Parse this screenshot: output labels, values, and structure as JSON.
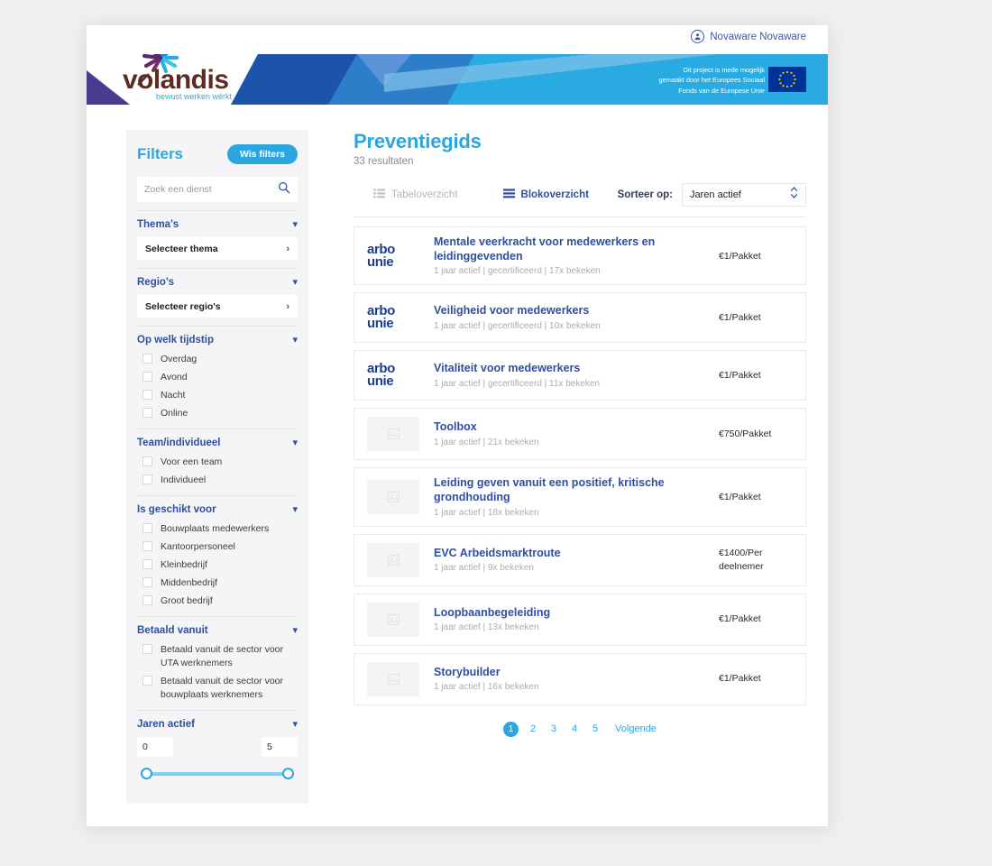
{
  "account": {
    "name": "Novaware Novaware",
    "icon": "user-circle-icon"
  },
  "banner": {
    "eu_text_line1": "Dit project is mede mogelijk",
    "eu_text_line2": "gemaakt door het Europees Sociaal",
    "eu_text_line3": "Fonds van de Europese Unie",
    "logo_name": "volandis",
    "logo_tagline": "bewust werken wérkt",
    "colors": {
      "cyan": "#29abe2",
      "mid_blue": "#2d7ec9",
      "dark_blue": "#1b54a8",
      "light_blue": "#7ec0e8",
      "purple": "#4b3b8f",
      "eu_flag_bg": "#003399",
      "eu_star": "#ffcc00"
    }
  },
  "sidebar": {
    "title": "Filters",
    "clear_button": "Wis filters",
    "search_placeholder": "Zoek een dienst",
    "search_value": "",
    "groups": [
      {
        "label": "Thema's",
        "type": "select",
        "select_label": "Selecteer thema"
      },
      {
        "label": "Regio's",
        "type": "select",
        "select_label": "Selecteer regio's"
      },
      {
        "label": "Op welk tijdstip",
        "type": "checkbox",
        "options": [
          "Overdag",
          "Avond",
          "Nacht",
          "Online"
        ]
      },
      {
        "label": "Team/individueel",
        "type": "checkbox",
        "options": [
          "Voor een team",
          "Individueel"
        ]
      },
      {
        "label": "Is geschikt voor",
        "type": "checkbox",
        "options": [
          "Bouwplaats medewerkers",
          "Kantoorpersoneel",
          "Kleinbedrijf",
          "Middenbedrijf",
          "Groot bedrijf"
        ]
      },
      {
        "label": "Betaald vanuit",
        "type": "checkbox",
        "options": [
          "Betaald vanuit de sector voor UTA werknemers",
          "Betaald vanuit de sector voor bouwplaats werknemers"
        ]
      },
      {
        "label": "Jaren actief",
        "type": "range",
        "min_value": "0",
        "max_value": "5"
      }
    ]
  },
  "main": {
    "title": "Preventiegids",
    "result_count": "33 resultaten",
    "view_table": "Tabeloverzicht",
    "view_block": "Blokoverzicht",
    "sort_label": "Sorteer op:",
    "sort_value": "Jaren actief",
    "results": [
      {
        "logo_type": "arbo",
        "logo_text_1": "arbo",
        "logo_text_2": "unie",
        "title": "Mentale veerkracht voor medewerkers en leidinggevenden",
        "meta": "1 jaar actief | gecertificeerd | 17x bekeken",
        "price": "€1/Pakket"
      },
      {
        "logo_type": "arbo",
        "logo_text_1": "arbo",
        "logo_text_2": "unie",
        "title": "Veiligheid voor medewerkers",
        "meta": "1 jaar actief | gecertificeerd | 10x bekeken",
        "price": "€1/Pakket"
      },
      {
        "logo_type": "arbo",
        "logo_text_1": "arbo",
        "logo_text_2": "unie",
        "title": "Vitaliteit voor medewerkers",
        "meta": "1 jaar actief | gecertificeerd | 11x bekeken",
        "price": "€1/Pakket"
      },
      {
        "logo_type": "placeholder",
        "title": "Toolbox",
        "meta": "1 jaar actief | 21x bekeken",
        "price": "€750/Pakket"
      },
      {
        "logo_type": "placeholder",
        "title": "Leiding geven vanuit een positief, kritische grondhouding",
        "meta": "1 jaar actief | 18x bekeken",
        "price": "€1/Pakket"
      },
      {
        "logo_type": "placeholder",
        "title": "EVC Arbeidsmarktroute",
        "meta": "1 jaar actief | 9x bekeken",
        "price": "€1400/Per deelnemer"
      },
      {
        "logo_type": "placeholder",
        "title": "Loopbaanbegeleiding",
        "meta": "1 jaar actief | 13x bekeken",
        "price": "€1/Pakket"
      },
      {
        "logo_type": "placeholder",
        "title": "Storybuilder",
        "meta": "1 jaar actief | 16x bekeken",
        "price": "€1/Pakket"
      }
    ],
    "pagination": {
      "pages": [
        "1",
        "2",
        "3",
        "4",
        "5"
      ],
      "active": "1",
      "next": "Volgende"
    }
  }
}
